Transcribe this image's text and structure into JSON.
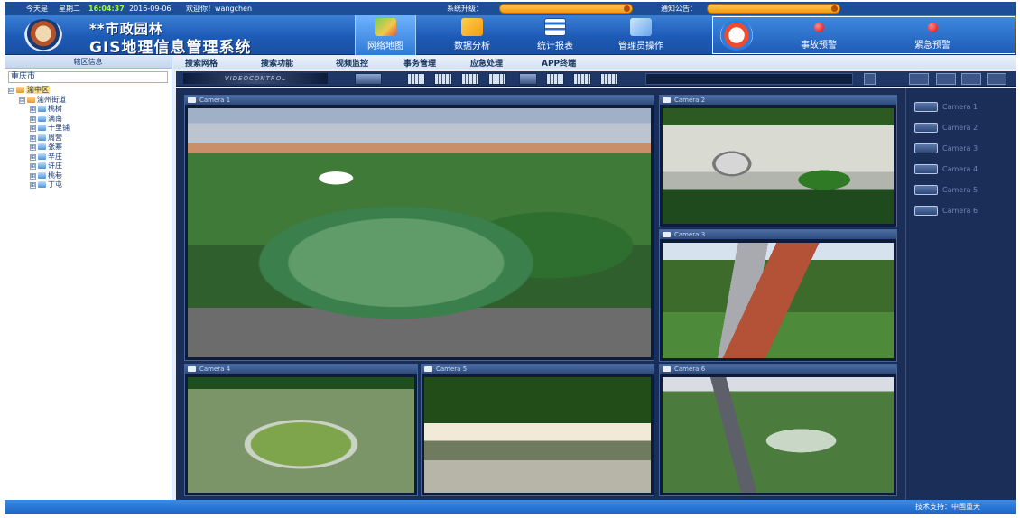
{
  "topbar": {
    "date_label": "今天是",
    "weekday": "星期二",
    "time": "16:04:37",
    "date": "2016-09-06",
    "welcome": "欢迎你！wangchen",
    "system_upgrade_label": "系统升级：",
    "system_upgrade_value": "",
    "notice_label": "通知公告：",
    "notice_value": ""
  },
  "header": {
    "title_line1": "**市政园林",
    "title_line2": "GIS地理信息管理系统",
    "nav": [
      {
        "label": "网络地图",
        "icon": "map-icon",
        "active": true
      },
      {
        "label": "数据分析",
        "icon": "folder-chart-icon",
        "active": false
      },
      {
        "label": "统计报表",
        "icon": "report-icon",
        "active": false
      },
      {
        "label": "管理员操作",
        "icon": "admin-monitor-icon",
        "active": false
      }
    ],
    "alerts": [
      {
        "label": "事故预警",
        "icon": "red-dot-icon"
      },
      {
        "label": "紧急预警",
        "icon": "red-dot-icon"
      }
    ]
  },
  "sidebar": {
    "header": "辖区信息",
    "search_value": "重庆市",
    "tree": [
      {
        "label": "渝中区",
        "level": 0,
        "toggle": "⊟",
        "type": "folder",
        "selected": true
      },
      {
        "label": "渝州街道",
        "level": 1,
        "toggle": "⊟",
        "type": "folder",
        "selected": false
      },
      {
        "label": "桃树",
        "level": 2,
        "toggle": "⊞",
        "type": "leaf",
        "selected": false
      },
      {
        "label": "满南",
        "level": 2,
        "toggle": "⊞",
        "type": "leaf",
        "selected": false
      },
      {
        "label": "十里铺",
        "level": 2,
        "toggle": "⊞",
        "type": "leaf",
        "selected": false
      },
      {
        "label": "周营",
        "level": 2,
        "toggle": "⊞",
        "type": "leaf",
        "selected": false
      },
      {
        "label": "张寨",
        "level": 2,
        "toggle": "⊞",
        "type": "leaf",
        "selected": false
      },
      {
        "label": "辛庄",
        "level": 2,
        "toggle": "⊞",
        "type": "leaf",
        "selected": false
      },
      {
        "label": "许庄",
        "level": 2,
        "toggle": "⊞",
        "type": "leaf",
        "selected": false
      },
      {
        "label": "桃巷",
        "level": 2,
        "toggle": "⊞",
        "type": "leaf",
        "selected": false
      },
      {
        "label": "丁屯",
        "level": 2,
        "toggle": "⊞",
        "type": "leaf",
        "selected": false
      }
    ]
  },
  "menubar": {
    "items": [
      "搜索网格",
      "搜索功能",
      "视频监控",
      "事务管理",
      "应急处理",
      "APP终端"
    ]
  },
  "video": {
    "brand": "VIDEOCONTROL",
    "panes": [
      {
        "title": "Camera 1",
        "scene": "aerial-park"
      },
      {
        "title": "Camera 2",
        "scene": "courtyard"
      },
      {
        "title": "Camera 3",
        "scene": "path"
      },
      {
        "title": "Camera 4",
        "scene": "garden"
      },
      {
        "title": "Camera 5",
        "scene": "gate"
      },
      {
        "title": "Camera 6",
        "scene": "road"
      }
    ]
  },
  "camera_list": [
    "Camera 1",
    "Camera 2",
    "Camera 3",
    "Camera 4",
    "Camera 5",
    "Camera 6"
  ],
  "footer": {
    "text": "技术支持：中国重天"
  },
  "colors": {
    "header_blue": "#1d5bb6",
    "accent_orange": "#f39b13",
    "time_green": "#9dff3d",
    "alert_red": "#e00000",
    "video_bg": "#1b2e57"
  }
}
